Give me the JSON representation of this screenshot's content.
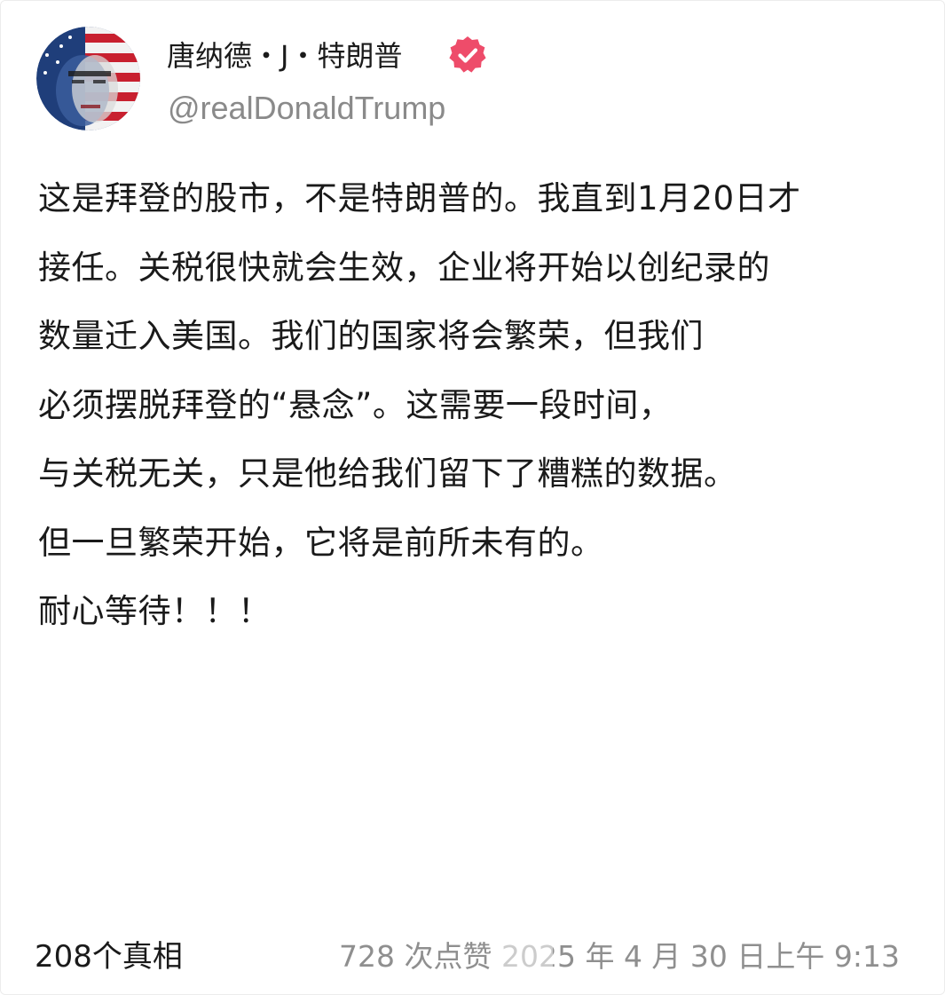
{
  "user": {
    "display_name": "唐纳德・J・特朗普",
    "handle": "@realDonaldTrump",
    "verified_icon": "verified-badge-icon",
    "verified_color": "#ee4c6a",
    "avatar_icon": "avatar-flag-portrait"
  },
  "post": {
    "lines": [
      "这是拜登的股市，不是特朗普的。我直到1月20日才",
      "接任。关税很快就会生效，企业将开始以创纪录的",
      "数量迁入美国。我们的国家将会繁荣，但我们",
      "必须摆脱拜登的“悬念”。这需要一段时间，",
      "与关税无关，只是他给我们留下了糟糕的数据。",
      "但一旦繁荣开始，它将是前所未有的。",
      "耐心等待！！！"
    ]
  },
  "footer": {
    "truth_count": "208个真相",
    "meta": "728 次点赞 2025 年 4 月 30 日上午 9:13"
  }
}
